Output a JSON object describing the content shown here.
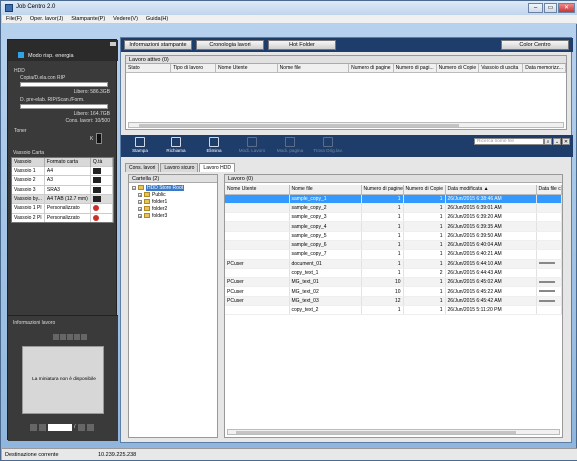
{
  "window": {
    "title": "Job Centro 2.0",
    "min": "–",
    "max": "▭",
    "close": "✕"
  },
  "menu": [
    "File(F)",
    "Oper. lavor(J)",
    "Stampante(P)",
    "Vedere(V)",
    "Guida(H)"
  ],
  "left": {
    "mode": "Modo risp. energia",
    "hdd_title": "HDD",
    "copy_label": "Copia/D.ela.con RIP",
    "copy_free": "Libero: 586.3GB",
    "prelab_label": "D. pre-elab. RIP/Scan./Form.",
    "prelab_free": "Libero: 164.7GB",
    "cons_lavori": "Cons. lavori: 10/500",
    "toner_title": "Toner",
    "toner_k": "K",
    "tray_title": "Vassoio Carta",
    "tray_headers": [
      "Vassoio",
      "Formato carta",
      "Q.tà"
    ],
    "trays": [
      {
        "name": "Vassoio 1",
        "size": "A4",
        "qty": "black"
      },
      {
        "name": "Vassoio 2",
        "size": "A3",
        "qty": "black"
      },
      {
        "name": "Vassoio 3",
        "size": "SRA3",
        "qty": "black"
      },
      {
        "name": "Vassoio by...",
        "size": "A4 TAB (12.7 mm)",
        "qty": "black"
      },
      {
        "name": "Vassoio 1 PI",
        "size": "Personalizzato",
        "qty": "red"
      },
      {
        "name": "Vassoio 2 PI",
        "size": "Personalizzato",
        "qty": "red"
      }
    ],
    "info_title": "Informazioni lavoro",
    "preview_text": "La miniatura non è disponibile",
    "page_sep": "/"
  },
  "top_buttons": [
    "Informazioni stampante",
    "Cronologia lavori",
    "Hot Folder",
    "Color Centro"
  ],
  "active_jobs": {
    "title": "Lavoro attivo (0)",
    "headers": [
      "Stato",
      "Tipo di lavoro",
      "Nome Utente",
      "Nome file",
      "Numero di pagine",
      "Numero di pagi...",
      "Numero di Copie",
      "Vassoio di uscita",
      "Data memorizz..."
    ]
  },
  "toolbar": {
    "tools": [
      {
        "label": "Stampa",
        "enabled": true,
        "icon": "print-icon"
      },
      {
        "label": "Richiama",
        "enabled": true,
        "icon": "recall-icon"
      },
      {
        "label": "Elimina",
        "enabled": true,
        "icon": "trash-icon"
      },
      {
        "label": "Modi. Lavoro",
        "enabled": false,
        "icon": "edit-job-icon"
      },
      {
        "label": "Modi. pagina",
        "enabled": false,
        "icon": "edit-page-icon"
      },
      {
        "label": "Trova Orig.lav.",
        "enabled": false,
        "icon": "find-original-icon"
      }
    ],
    "search_placeholder": "Ricerca nome file",
    "search_btn": "⌕",
    "expand_btn": "⌄",
    "close_btn": "✕"
  },
  "tabs": [
    "Cons. lavori",
    "Lavoro sicuro",
    "Lavoro HDD"
  ],
  "folders": {
    "title": "Cartella (2)",
    "root": "HDD Store Root",
    "items": [
      "Public",
      "folder1",
      "folder2",
      "folder3"
    ]
  },
  "jobs": {
    "title": "Lavoro (0)",
    "headers": [
      "Nome Utente",
      "Nome file",
      "Numero di pagine",
      "Numero di Copie",
      "Data modificata",
      "Data file c"
    ],
    "sort_indicator": "▲",
    "rows": [
      {
        "user": "",
        "file": "sample_copy_1",
        "pages": "1",
        "copies": "1",
        "date": "26/Jun/2015 6:38:46 AM"
      },
      {
        "user": "",
        "file": "sample_copy_2",
        "pages": "1",
        "copies": "1",
        "date": "26/Jun/2015 6:39:01 AM"
      },
      {
        "user": "",
        "file": "sample_copy_3",
        "pages": "1",
        "copies": "1",
        "date": "26/Jun/2015 6:39:20 AM"
      },
      {
        "user": "",
        "file": "sample_copy_4",
        "pages": "1",
        "copies": "1",
        "date": "26/Jun/2015 6:39:35 AM"
      },
      {
        "user": "",
        "file": "sample_copy_5",
        "pages": "1",
        "copies": "1",
        "date": "26/Jun/2015 6:39:50 AM"
      },
      {
        "user": "",
        "file": "sample_copy_6",
        "pages": "1",
        "copies": "1",
        "date": "26/Jun/2015 6:40:04 AM"
      },
      {
        "user": "",
        "file": "sample_copy_7",
        "pages": "1",
        "copies": "1",
        "date": "26/Jun/2015 6:40:21 AM"
      },
      {
        "user": "PCuser",
        "file": "document_01",
        "pages": "1",
        "copies": "1",
        "date": "26/Jun/2015 6:44:10 AM"
      },
      {
        "user": "",
        "file": "copy_text_1",
        "pages": "1",
        "copies": "2",
        "date": "26/Jun/2015 6:44:43 AM"
      },
      {
        "user": "PCuser",
        "file": "MG_text_01",
        "pages": "10",
        "copies": "1",
        "date": "26/Jun/2015 6:45:02 AM"
      },
      {
        "user": "PCuser",
        "file": "MG_text_02",
        "pages": "10",
        "copies": "1",
        "date": "26/Jun/2015 6:45:22 AM"
      },
      {
        "user": "PCuser",
        "file": "MG_text_03",
        "pages": "12",
        "copies": "1",
        "date": "26/Jun/2015 6:45:42 AM"
      },
      {
        "user": "",
        "file": "copy_text_2",
        "pages": "1",
        "copies": "1",
        "date": "26/Jun/2015 5:11:20 PM"
      }
    ]
  },
  "status": {
    "label": "Destinazione corrente",
    "value": "10.239.225.238"
  }
}
